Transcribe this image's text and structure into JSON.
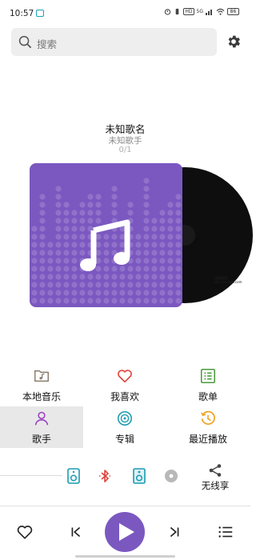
{
  "status_bar": {
    "time": "10:57",
    "battery": "86",
    "network_label": "5G",
    "hd_label": "HD"
  },
  "search": {
    "placeholder": "搜索",
    "icon": "search-icon"
  },
  "settings": {
    "icon": "gear-icon"
  },
  "now_playing": {
    "title": "未知歌名",
    "artist": "未知歌手",
    "index": "0/1"
  },
  "colors": {
    "accent": "#7b58c0",
    "heart": "#e0443c",
    "list_green": "#4a9a3c",
    "recent_orange": "#f0a020",
    "album_teal": "#1a9bb0"
  },
  "watermark": {
    "line1": "流量知道",
    "line2": "bbs.liuxingw.com"
  },
  "menu": [
    {
      "label": "本地音乐",
      "icon": "folder-music-icon"
    },
    {
      "label": "我喜欢",
      "icon": "heart-icon"
    },
    {
      "label": "歌单",
      "icon": "playlist-grid-icon"
    },
    {
      "label": "歌手",
      "icon": "person-icon"
    },
    {
      "label": "专辑",
      "icon": "album-disc-icon"
    },
    {
      "label": "最近播放",
      "icon": "history-icon"
    }
  ],
  "devices": {
    "share_label": "无线享"
  },
  "player_bar": {
    "like": "heart-outline-icon",
    "prev": "previous-icon",
    "play": "play-icon",
    "next": "next-icon",
    "queue": "queue-list-icon"
  }
}
